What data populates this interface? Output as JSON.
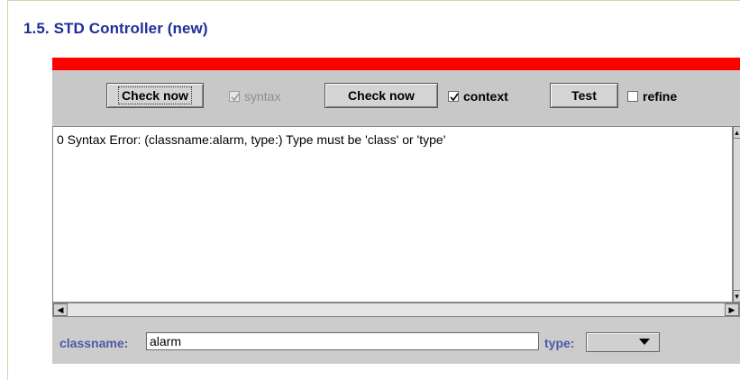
{
  "section": {
    "title": "1.5. STD Controller (new)"
  },
  "toolbar": {
    "check_syntax_button": "Check now",
    "syntax_checkbox": {
      "label": "syntax",
      "checked": true,
      "disabled": true
    },
    "check_context_button": "Check now",
    "context_checkbox": {
      "label": "context",
      "checked": true,
      "disabled": false
    },
    "test_button": "Test",
    "refine_checkbox": {
      "label": "refine",
      "checked": false,
      "disabled": false
    }
  },
  "output": {
    "text": "0 Syntax Error: (classname:alarm, type:) Type must be 'class' or 'type'"
  },
  "form": {
    "classname_label": "classname:",
    "classname_value": "alarm",
    "type_label": "type:",
    "type_value": ""
  },
  "colors": {
    "title": "#1f2f9a",
    "accent_bar": "#ff0000",
    "panel": "#cccccc",
    "form_label": "#4a5aa5"
  },
  "icons": {
    "checkmark": "check-icon",
    "dropdown": "chevron-down-icon",
    "scroll_left": "arrow-left-icon",
    "scroll_right": "arrow-right-icon",
    "scroll_up": "arrow-up-icon",
    "scroll_down": "arrow-down-icon"
  }
}
